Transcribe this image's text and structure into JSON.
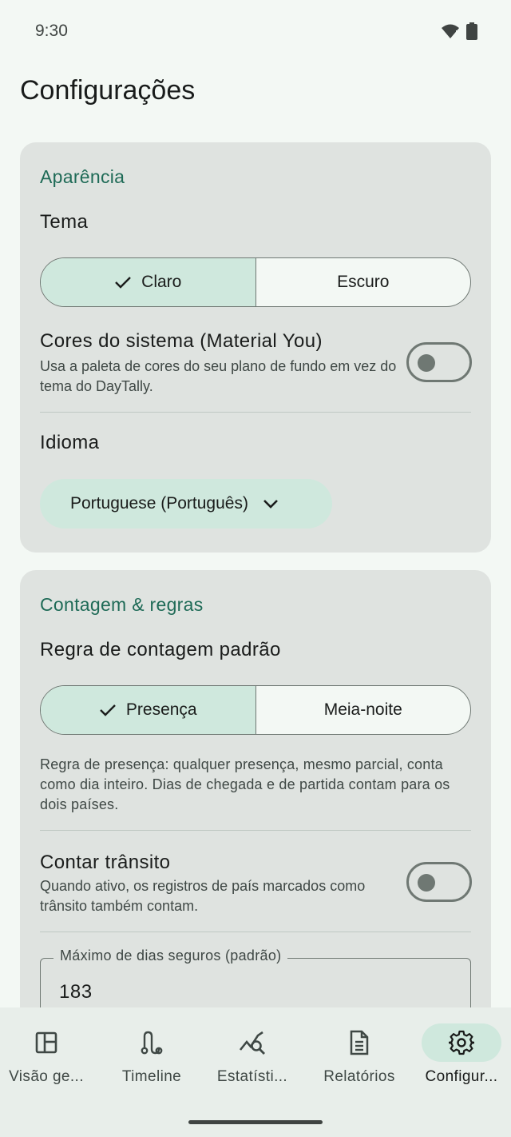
{
  "status_bar": {
    "time": "9:30"
  },
  "page": {
    "title": "Configurações"
  },
  "appearance": {
    "section_title": "Aparência",
    "theme_label": "Tema",
    "theme_options": [
      "Claro",
      "Escuro"
    ],
    "theme_selected": "Claro",
    "system_colors_title": "Cores do sistema (Material You)",
    "system_colors_desc": "Usa a paleta de cores do seu plano de fundo em vez do tema do DayTally.",
    "system_colors_on": false,
    "language_label": "Idioma",
    "language_value": "Portuguese (Português)"
  },
  "counting": {
    "section_title": "Contagem & regras",
    "rule_label": "Regra de contagem padrão",
    "rule_options": [
      "Presença",
      "Meia-noite"
    ],
    "rule_selected": "Presença",
    "rule_help": "Regra de presença: qualquer presença, mesmo parcial, conta como dia inteiro. Dias de chegada e de partida contam para os dois países.",
    "transit_title": "Contar trânsito",
    "transit_desc": "Quando ativo, os registros de país marcados como trânsito também contam.",
    "transit_on": false,
    "max_days_label": "Máximo de dias seguros (padrão)",
    "max_days_value": "183"
  },
  "bottom_nav": {
    "items": [
      {
        "label": "Visão ge...",
        "icon": "dashboard-icon"
      },
      {
        "label": "Timeline",
        "icon": "timeline-icon"
      },
      {
        "label": "Estatísti...",
        "icon": "stats-icon"
      },
      {
        "label": "Relatórios",
        "icon": "report-icon"
      },
      {
        "label": "Configur...",
        "icon": "gear-icon"
      }
    ],
    "active_index": 4
  },
  "colors": {
    "accent": "#1f6b57",
    "selected_bg": "#cfe8dd",
    "card_bg": "#dfe3e0",
    "page_bg": "#f3f8f4"
  }
}
